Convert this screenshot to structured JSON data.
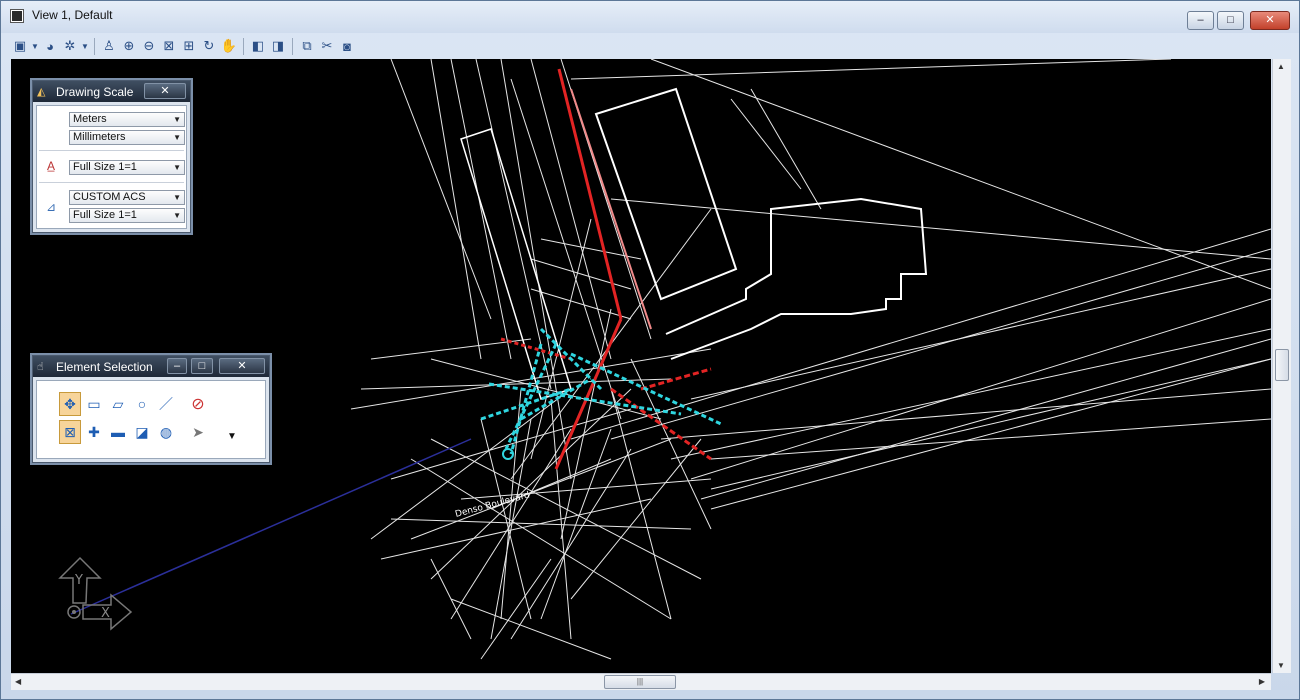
{
  "window": {
    "title": "View 1, Default",
    "controls": {
      "minimize": "–",
      "maximize": "□",
      "close": "✕"
    }
  },
  "toolbar": {
    "icons": [
      "view-attributes-icon",
      "dropdown-icon",
      "display-style-icon",
      "lighting-icon",
      "dropdown-icon",
      "update-view-icon",
      "zoom-in-icon",
      "zoom-out-icon",
      "window-area-icon",
      "fit-view-icon",
      "rotate-view-icon",
      "pan-view-icon",
      "previous-view-icon",
      "next-view-icon",
      "view-toggles-icon",
      "clip-volume-icon",
      "camera-icon"
    ]
  },
  "drawing_scale": {
    "title": "Drawing Scale",
    "close": "✕",
    "master_units": "Meters",
    "sub_units": "Millimeters",
    "annotation_scale": "Full Size 1=1",
    "acs": "CUSTOM ACS",
    "acs_scale": "Full Size 1=1"
  },
  "element_selection": {
    "title": "Element Selection",
    "min": "–",
    "max": "□",
    "close": "✕",
    "tools_row1": [
      "element-select-icon",
      "block-select-icon",
      "shape-select-icon",
      "circle-select-icon",
      "line-select-icon"
    ],
    "tools_row2": [
      "toggle-select-icon",
      "add-select-icon",
      "subtract-select-icon",
      "invert-select-icon",
      "global-select-icon"
    ]
  },
  "drawing": {
    "labels": [
      "Denso Boulevard"
    ],
    "view_axis": {
      "x": "X",
      "y": "Y"
    }
  },
  "colors": {
    "canvas": "#000000",
    "linework": "#e6e6e6",
    "red": "#e32424",
    "cyan": "#2fd6e0",
    "blue": "#2b2f9a"
  }
}
